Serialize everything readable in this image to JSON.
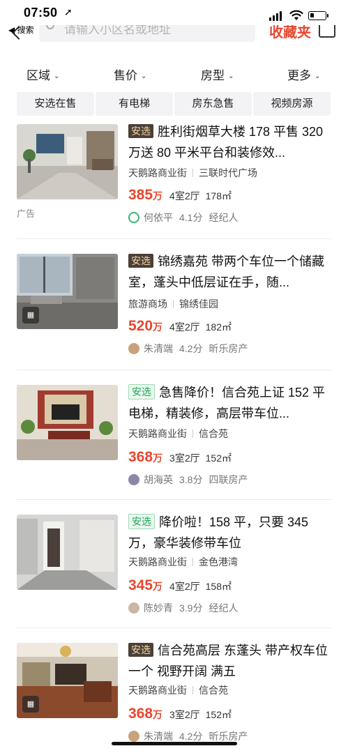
{
  "status_bar": {
    "time": "07:50",
    "back_app": "◀ 搜索"
  },
  "search": {
    "placeholder": "请输入小区名或地址",
    "favorites_label": "收藏夹"
  },
  "filters": [
    {
      "label": "区域"
    },
    {
      "label": "售价"
    },
    {
      "label": "房型"
    },
    {
      "label": "更多"
    }
  ],
  "tags": [
    "安选在售",
    "有电梯",
    "房东急售",
    "视频房源"
  ],
  "listings": [
    {
      "badge": "安选",
      "badge_style": "dark",
      "title": "胜利街烟草大楼 178 平售 320 万送 80 平米平台和装修效...",
      "area": "天鹅路商业街",
      "community": "三联时代广场",
      "price": "385",
      "price_unit": "万",
      "layout": "4室2厅",
      "size": "178㎡",
      "agent": "何依平",
      "score": "4.1分",
      "agency": "经纪人",
      "ad_label": "广告",
      "has_vr": false
    },
    {
      "badge": "安选",
      "badge_style": "dark",
      "title": "锦绣嘉苑 带两个车位一个储藏室，蓬头中低层证在手，随...",
      "area": "旅游商场",
      "community": "锦绣佳园",
      "price": "520",
      "price_unit": "万",
      "layout": "4室2厅",
      "size": "182㎡",
      "agent": "朱清端",
      "score": "4.2分",
      "agency": "昕乐房产",
      "has_vr": true
    },
    {
      "badge": "安选",
      "badge_style": "green",
      "title": "急售降价！信合苑上证 152 平电梯，精装修，高层带车位...",
      "area": "天鹅路商业街",
      "community": "信合苑",
      "price": "368",
      "price_unit": "万",
      "layout": "3室2厅",
      "size": "152㎡",
      "agent": "胡海英",
      "score": "3.8分",
      "agency": "四联房产",
      "has_vr": false
    },
    {
      "badge": "安选",
      "badge_style": "green",
      "title": "降价啦！158 平，只要 345 万，豪华装修带车位",
      "area": "天鹅路商业街",
      "community": "金色港湾",
      "price": "345",
      "price_unit": "万",
      "layout": "4室2厅",
      "size": "158㎡",
      "agent": "陈妙青",
      "score": "3.9分",
      "agency": "经纪人",
      "has_vr": false
    },
    {
      "badge": "安选",
      "badge_style": "dark",
      "title": "信合苑高层 东蓬头 带产权车位一个 视野开阔 满五",
      "area": "天鹅路商业街",
      "community": "信合苑",
      "price": "368",
      "price_unit": "万",
      "layout": "3室2厅",
      "size": "152㎡",
      "agent": "朱清端",
      "score": "4.2分",
      "agency": "昕乐房产",
      "has_vr": true
    }
  ]
}
